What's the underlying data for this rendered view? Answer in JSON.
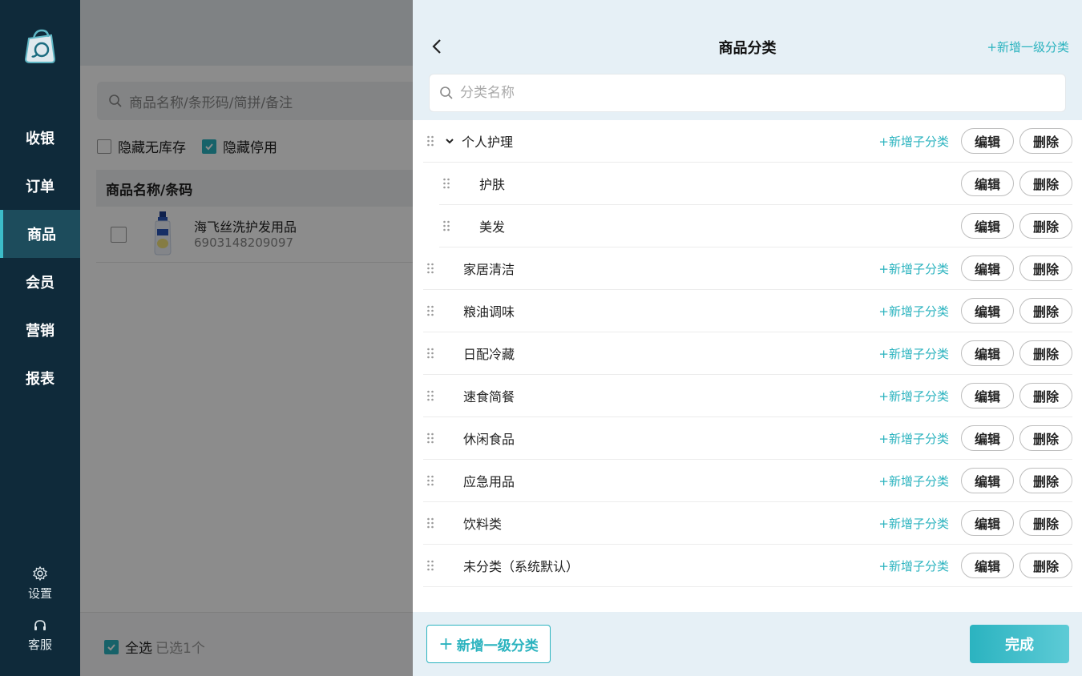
{
  "sidebar": {
    "nav": [
      "收银",
      "订单",
      "商品",
      "会员",
      "营销",
      "报表"
    ],
    "active_index": 2,
    "settings_label": "设置",
    "service_label": "客服"
  },
  "main": {
    "search_placeholder": "商品名称/条形码/简拼/备注",
    "filters": [
      {
        "label": "隐藏无库存",
        "checked": false
      },
      {
        "label": "隐藏停用",
        "checked": true
      }
    ],
    "table_header": "商品名称/条码",
    "product": {
      "name": "海飞丝洗护发用品",
      "code": "6903148209097"
    },
    "footer": {
      "select_all": "全选",
      "selected": "已选1个"
    }
  },
  "panel": {
    "title": "商品分类",
    "add_top_link": "+新增一级分类",
    "search_placeholder": "分类名称",
    "add_sub_label": "+新增子分类",
    "edit_label": "编辑",
    "delete_label": "删除",
    "categories": [
      {
        "name": "个人护理",
        "level": 1,
        "expanded": true
      },
      {
        "name": "护肤",
        "level": 2
      },
      {
        "name": "美发",
        "level": 2
      },
      {
        "name": "家居清洁",
        "level": 1
      },
      {
        "name": "粮油调味",
        "level": 1
      },
      {
        "name": "日配冷藏",
        "level": 1
      },
      {
        "name": "速食简餐",
        "level": 1
      },
      {
        "name": "休闲食品",
        "level": 1
      },
      {
        "name": "应急用品",
        "level": 1
      },
      {
        "name": "饮料类",
        "level": 1
      },
      {
        "name": "未分类（系统默认）",
        "level": 1
      }
    ],
    "add_first_button": "新增一级分类",
    "done_button": "完成"
  },
  "colors": {
    "accent": "#2bb3bf",
    "sidebar_bg": "#0f2a3a",
    "panel_header_bg": "#e6f0f6"
  }
}
